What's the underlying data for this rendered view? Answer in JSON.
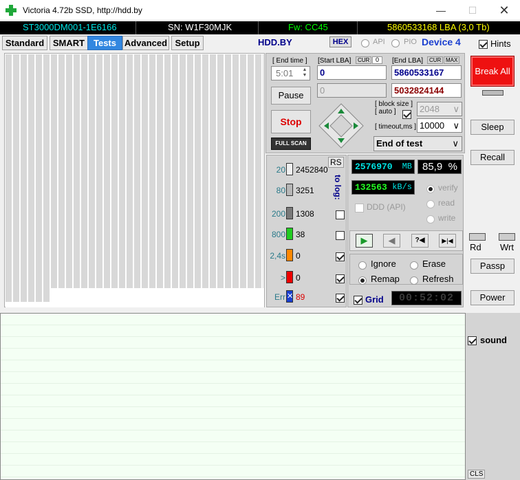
{
  "window": {
    "title": "Victoria 4.72b SSD, http://hdd.by",
    "min_glyph": "—",
    "max_glyph": "☐",
    "close_glyph": "✕"
  },
  "infobar": {
    "model": "ST3000DM001-1E6166",
    "serial": "SN: W1F30MJK",
    "firmware": "Fw: CC45",
    "capacity": "5860533168 LBA (3,0 Tb)",
    "colors": {
      "model": "#00e5e5",
      "serial": "#ffffff",
      "firmware": "#00ff00",
      "capacity": "#ffff00"
    }
  },
  "tabs": [
    {
      "label": "Standard",
      "active": false
    },
    {
      "label": "SMART",
      "active": false
    },
    {
      "label": "Tests",
      "active": true
    },
    {
      "label": "Advanced",
      "active": false
    },
    {
      "label": "Setup",
      "active": false
    }
  ],
  "toolbar": {
    "hddby": "HDD.BY",
    "hex": "HEX",
    "api": "API",
    "pio": "PIO",
    "device": "Device 4",
    "hints": "Hints"
  },
  "controls": {
    "end_time_label": "[ End time ]",
    "end_time_value": "5:01",
    "start_lba_label": "[Start LBA]",
    "cur_label": "CUR",
    "cur_value": "0",
    "end_lba_label": "[End LBA]",
    "end_cur_label": "CUR",
    "max_label": "MAX",
    "start_lba": "0",
    "end_lba": "5860533167",
    "cur_lba": "0",
    "remaining_lba": "5032824144",
    "pause": "Pause",
    "stop": "Stop",
    "full_scan": "FULL SCAN",
    "block_size_label": "[ block size ]",
    "auto_label": "[ auto ]",
    "block_size": "2048",
    "timeout_label": "[ timeout,ms ]",
    "timeout": "10000",
    "end_action": "End of test",
    "dropdown_glyph": "∨"
  },
  "stats": {
    "rs": "RS",
    "to_log": "to log:",
    "rows": [
      {
        "threshold": "20",
        "count": "2452840",
        "color": "#f0f0f0",
        "threshold_color": "#2a7a8a",
        "count_color": "#000000"
      },
      {
        "threshold": "80",
        "count": "3251",
        "color": "#b8b8b8",
        "threshold_color": "#2a7a8a",
        "count_color": "#000000"
      },
      {
        "threshold": "200",
        "count": "1308",
        "color": "#7a7a7a",
        "threshold_color": "#2a7a8a",
        "count_color": "#000000"
      },
      {
        "threshold": "800",
        "count": "38",
        "color": "#22cc22",
        "threshold_color": "#2a7a8a",
        "count_color": "#000000"
      },
      {
        "threshold": "2,4s",
        "count": "0",
        "color": "#ff8800",
        "threshold_color": "#2a7a8a",
        "count_color": "#000000"
      },
      {
        "threshold": ">",
        "count": "0",
        "color": "#ee0000",
        "threshold_color": "#2a7a8a",
        "count_color": "#000000"
      },
      {
        "threshold": "Err",
        "count": "89",
        "color": "#1a3fd0",
        "threshold_color": "#2a7a8a",
        "count_color": "#dd0000"
      }
    ],
    "err_glyph": "✕"
  },
  "progress": {
    "mb": "2576970",
    "mb_unit": "MB",
    "percent": "85,9",
    "percent_unit": "%",
    "speed": "132563",
    "speed_unit": "kB/s",
    "verify": "verify",
    "read": "read",
    "write": "write",
    "ddd": "DDD (API)",
    "ignore": "Ignore",
    "erase": "Erase",
    "remap": "Remap",
    "refresh": "Refresh",
    "grid": "Grid",
    "timer": "00:52:02",
    "play_glyph": "▶",
    "back_glyph": "◀",
    "skip_glyph": "?◀",
    "end_glyph": "▶|◀"
  },
  "side": {
    "break_all": "Break All",
    "sleep": "Sleep",
    "recall": "Recall",
    "rd": "Rd",
    "wrt": "Wrt",
    "passp": "Passp",
    "power": "Power",
    "sound": "sound",
    "cls": "CLS"
  }
}
